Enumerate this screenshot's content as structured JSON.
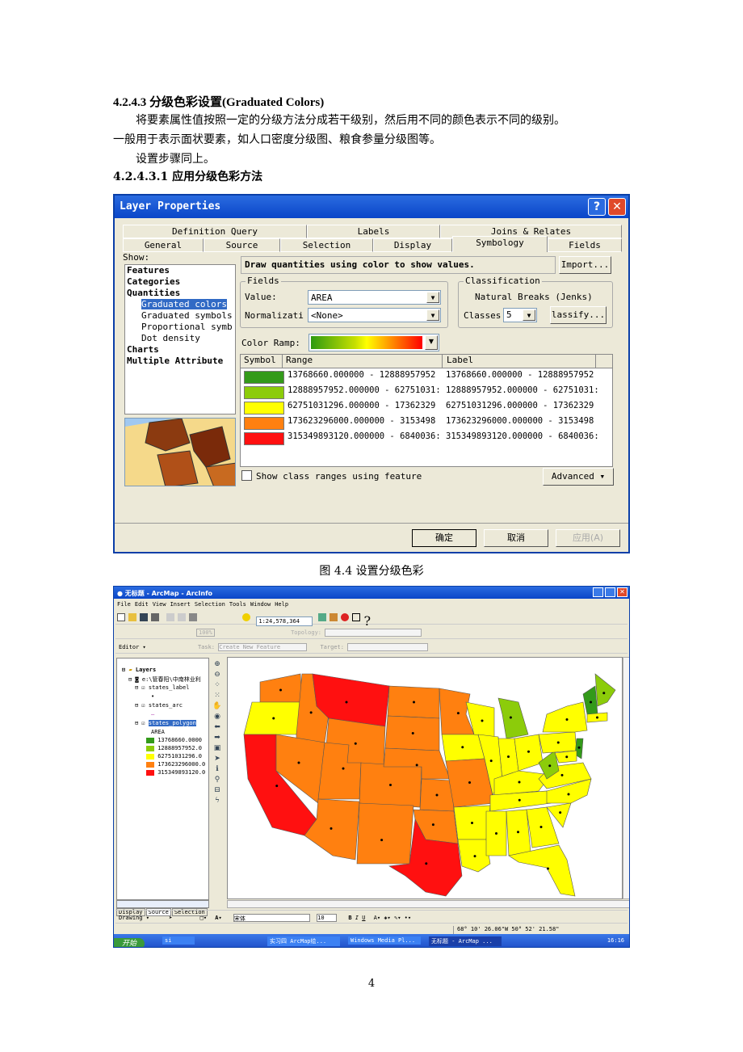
{
  "heading": "4.2.4.3 分级色彩设置(Graduated Colors)",
  "paragraph1_line1": "将要素属性值按照一定的分级方法分成若干级别，然后用不同的颜色表示不同的级别。",
  "paragraph1_line2": "一般用于表示面状要素，如人口密度分级图、粮食参量分级图等。",
  "paragraph2": "设置步骤同上。",
  "subheading": "4.2.4.3.1 应用分级色彩方法",
  "dialog": {
    "title": "Layer Properties",
    "tabs_row1": [
      "Definition Query",
      "Labels",
      "Joins & Relates"
    ],
    "tabs_row2": [
      "General",
      "Source",
      "Selection",
      "Display",
      "Symbology",
      "Fields"
    ],
    "active_tab": "Symbology",
    "show_label": "Show:",
    "show_items": [
      {
        "label": "Features",
        "bold": true
      },
      {
        "label": "Categories",
        "bold": true
      },
      {
        "label": "Quantities",
        "bold": true
      },
      {
        "label": "Graduated colors",
        "selected": true
      },
      {
        "label": "Graduated symbols"
      },
      {
        "label": "Proportional symb"
      },
      {
        "label": "Dot density"
      },
      {
        "label": "Charts",
        "bold": true
      },
      {
        "label": "Multiple Attribute",
        "bold": true
      }
    ],
    "description": "Draw quantities using color to show values.",
    "import_button": "Import...",
    "fields_group": "Fields",
    "value_label": "Value:",
    "value": "AREA",
    "normalization_label": "Normalizati",
    "normalization": "<None>",
    "classification_group": "Classification",
    "method": "Natural Breaks (Jenks)",
    "classes_label": "Classes",
    "classes": "5",
    "classify_button": "lassify...",
    "color_ramp_label": "Color Ramp:",
    "columns": [
      "Symbol",
      "Range",
      "Label"
    ],
    "classes_list": [
      {
        "color": "#339a1a",
        "range": "13768660.000000 - 12888957952",
        "label": "13768660.000000 - 12888957952"
      },
      {
        "color": "#8ccc0a",
        "range": "12888957952.000000 - 62751031:",
        "label": "12888957952.000000 - 62751031:"
      },
      {
        "color": "#ffff00",
        "range": "62751031296.000000 - 17362329",
        "label": "62751031296.000000 - 17362329"
      },
      {
        "color": "#ff8010",
        "range": "173623296000.000000 - 3153498",
        "label": "173623296000.000000 - 3153498"
      },
      {
        "color": "#ff1010",
        "range": "315349893120.000000 - 6840036:",
        "label": "315349893120.000000 - 6840036:"
      }
    ],
    "show_class_ranges": "Show class ranges using feature",
    "advanced_button": "Advanced",
    "ok_button": "确定",
    "cancel_button": "取消",
    "apply_button": "应用(A)"
  },
  "caption1": "图 4.4 设置分级色彩",
  "arcmap": {
    "title": "无标题 - ArcMap - ArcInfo",
    "menu": [
      "File",
      "Edit",
      "View",
      "Insert",
      "Selection",
      "Tools",
      "Window",
      "Help"
    ],
    "scale": "1:24,578,364",
    "zoom_pct": "100%",
    "topology_label": "Topology:",
    "editor_label": "Editor",
    "task_label": "Task:",
    "task_value": "Create New Feature",
    "target_label": "Target:",
    "toc": {
      "root": "Layers",
      "path": "e:\\管春阳\\中南林业利",
      "layers": [
        "states_label",
        "states_arc",
        "states_polygon"
      ],
      "field": "AREA",
      "legend": [
        "13768660.0000",
        "12888957952.0",
        "62751031296.0",
        "173623296000.0",
        "315349893120.0"
      ],
      "tabs": [
        "Display",
        "Source",
        "Selection"
      ]
    },
    "drawing_label": "Drawing",
    "font": "宋体",
    "font_size": "10",
    "coords": "68° 10' 26.06\"W  50° 52' 21.58\"",
    "taskbar": {
      "start": "开始",
      "items": [
        "si",
        "实习四 ArcMap绘...",
        "Windows Media Pl...",
        "无标题 - ArcMap ..."
      ],
      "clock": "16:16"
    }
  },
  "page_number": "4"
}
